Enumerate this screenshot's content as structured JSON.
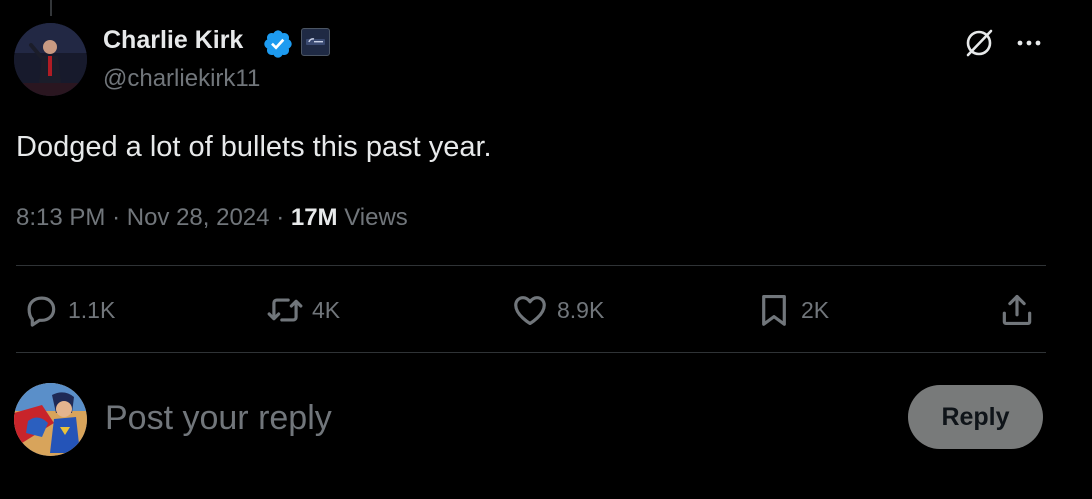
{
  "author": {
    "name": "Charlie Kirk",
    "handle": "@charliekirk11",
    "verified": true
  },
  "tweet": {
    "text": "Dodged a lot of bullets this past year.",
    "time": "8:13 PM",
    "date": "Nov 28, 2024",
    "separator": "·",
    "views_count": "17M",
    "views_label": "Views"
  },
  "actions": {
    "replies": "1.1K",
    "reposts": "4K",
    "likes": "8.9K",
    "bookmarks": "2K"
  },
  "reply_box": {
    "placeholder": "Post your reply",
    "button_label": "Reply"
  },
  "colors": {
    "background": "#000000",
    "primary_text": "#e7e9ea",
    "secondary_text": "#71767b",
    "divider": "#2f3336",
    "verified_badge": "#1d9bf0",
    "reply_button_bg": "#787a7a"
  },
  "icons": {
    "verified": "verified-badge-icon",
    "affiliate": "affiliate-badge-icon",
    "grok": "grok-icon",
    "more": "more-icon",
    "reply": "reply-icon",
    "repost": "repost-icon",
    "like": "like-icon",
    "bookmark": "bookmark-icon",
    "share": "share-icon"
  }
}
